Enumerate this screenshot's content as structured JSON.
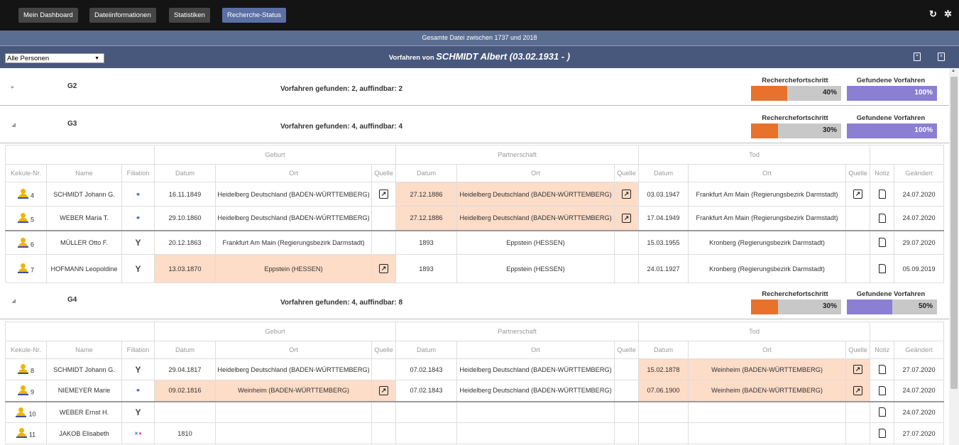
{
  "nav": {
    "buttons": [
      "Mein Dashboard",
      "Dateiinformationen",
      "Statistiken",
      "Recherche-Status"
    ],
    "active": "Recherche-Status",
    "refresh_icon": "refresh-icon",
    "settings_icon": "gear-icon"
  },
  "info": {
    "text": "Gesamte Datei zwischen 1737 und 2018"
  },
  "titlebar": {
    "select_value": "Alle Personen",
    "prefix": "Vorfahren von",
    "person": "SCHMIDT Albert (03.02.1931 - )",
    "icons": [
      "pdf-icon",
      "excel-icon"
    ]
  },
  "progress_labels": {
    "research": "Recherchefortschritt",
    "found": "Gefundene Vorfahren"
  },
  "colors": {
    "orange": "#e8712c",
    "blue": "#8a7fd2",
    "highlight": "#fddcc8"
  },
  "headers": {
    "groups": {
      "geburt": "Geburt",
      "partnerschaft": "Partnerschaft",
      "tod": "Tod"
    },
    "cols": {
      "kekule": "Kekule-Nr.",
      "name": "Name",
      "filiation": "Filiation",
      "datum": "Datum",
      "ort": "Ort",
      "quelle": "Quelle",
      "notiz": "Notiz",
      "geaendert": "Geändert"
    }
  },
  "generations": [
    {
      "name": "G2",
      "summary": "Vorfahren gefunden: 2, auffindbar: 2",
      "research": "40%",
      "research_value": 0.4,
      "found": "100%",
      "found_value": 1.0,
      "expanded": false
    },
    {
      "name": "G3",
      "summary": "Vorfahren gefunden: 4, auffindbar: 4",
      "research": "30%",
      "research_value": 0.3,
      "found": "100%",
      "found_value": 1.0,
      "expanded": true
    },
    {
      "name": "G4",
      "summary": "Vorfahren gefunden: 4, auffindbar: 8",
      "research": "30%",
      "research_value": 0.3,
      "found": "50%",
      "found_value": 0.5,
      "expanded": true
    }
  ],
  "g3_rows": [
    {
      "k": "4",
      "name": "SCHMIDT Johann G.",
      "fil": "both",
      "bd": "16.11.1849",
      "bo": "Heidelberg Deutschland (BADEN-WÜRTTEMBERG)",
      "bq": true,
      "bh": false,
      "pd": "27.12.1886",
      "po": "Heidelberg Deutschland (BADEN-WÜRTTEMBERG)",
      "pq": true,
      "ph": true,
      "td": "03.03.1947",
      "to": "Frankfurt Am Main (Regierungsbezirk Darmstadt)",
      "tq": true,
      "th": false,
      "ch": "24.07.2020"
    },
    {
      "k": "5",
      "name": "WEBER Maria T.",
      "fil": "both",
      "bd": "29.10.1860",
      "bo": "Heidelberg Deutschland (BADEN-WÜRTTEMBERG)",
      "bq": false,
      "bh": false,
      "pd": "27.12.1886",
      "po": "Heidelberg Deutschland (BADEN-WÜRTTEMBERG)",
      "pq": true,
      "ph": true,
      "td": "17.04.1949",
      "to": "Frankfurt Am Main (Regierungsbezirk Darmstadt)",
      "tq": false,
      "th": false,
      "ch": "24.07.2020"
    },
    {
      "k": "6",
      "name": "MÜLLER Otto F.",
      "fil": "none",
      "bd": "20.12.1863",
      "bo": "Frankfurt Am Main (Regierungsbezirk Darmstadt)",
      "bq": false,
      "bh": false,
      "pd": "1893",
      "po": "Eppstein (HESSEN)",
      "pq": false,
      "ph": false,
      "td": "15.03.1955",
      "to": "Kronberg (Regierungsbezirk Darmstadt)",
      "tq": false,
      "th": false,
      "ch": "29.07.2020"
    },
    {
      "k": "7",
      "name": "HOFMANN Leopoldine",
      "fil": "none",
      "bd": "13.03.1870",
      "bo": "Eppstein (HESSEN)",
      "bq": true,
      "bh": true,
      "pd": "1893",
      "po": "Eppstein (HESSEN)",
      "pq": false,
      "ph": false,
      "td": "24.01.1927",
      "to": "Kronberg (Regierungsbezirk Darmstadt)",
      "tq": false,
      "th": false,
      "ch": "05.09.2019"
    }
  ],
  "g4_rows": [
    {
      "k": "8",
      "name": "SCHMIDT Johann G.",
      "fil": "none",
      "bd": "29.04.1817",
      "bo": "Heidelberg Deutschland (BADEN-WÜRTTEMBERG)",
      "bq": false,
      "bh": false,
      "pd": "07.02.1843",
      "po": "Heidelberg Deutschland (BADEN-WÜRTTEMBERG)",
      "pq": false,
      "ph": false,
      "td": "15.02.1878",
      "to": "Weinheim (BADEN-WÜRTTEMBERG)",
      "tq": true,
      "th": true,
      "ch": "27.07.2020"
    },
    {
      "k": "9",
      "name": "NIEMEYER Marie",
      "fil": "both",
      "bd": "09.02.1816",
      "bo": "Weinheim (BADEN-WÜRTTEMBERG)",
      "bq": true,
      "bh": true,
      "pd": "07.02.1843",
      "po": "Heidelberg Deutschland (BADEN-WÜRTTEMBERG)",
      "pq": false,
      "ph": false,
      "td": "07.06.1900",
      "to": "Weinheim (BADEN-WÜRTTEMBERG)",
      "tq": true,
      "th": true,
      "ch": "24.07.2020"
    },
    {
      "k": "10",
      "name": "WEBER Ernst H.",
      "fil": "none",
      "bd": "",
      "bo": "",
      "bq": false,
      "bh": false,
      "pd": "",
      "po": "",
      "pq": false,
      "ph": false,
      "td": "",
      "to": "",
      "tq": false,
      "th": false,
      "ch": "24.07.2020"
    },
    {
      "k": "11",
      "name": "JAKOB Elisabeth",
      "fil": "partial",
      "bd": "1810",
      "bo": "",
      "bq": false,
      "bh": false,
      "pd": "",
      "po": "",
      "pq": false,
      "ph": false,
      "td": "",
      "to": "",
      "tq": false,
      "th": false,
      "ch": "27.07.2020"
    }
  ]
}
